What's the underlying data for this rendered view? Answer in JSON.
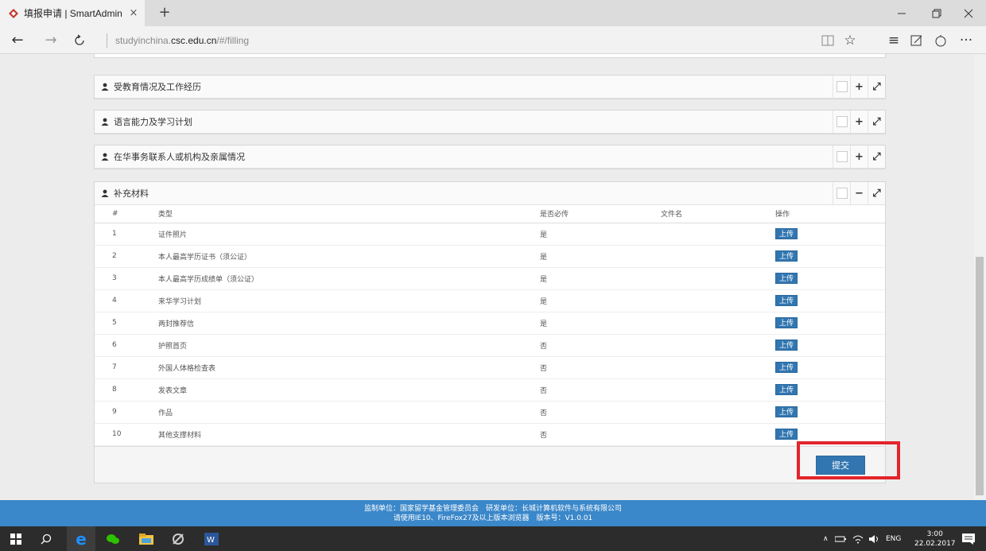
{
  "browser": {
    "tab_title": "填报申请 | SmartAdmin",
    "tab_close": "×",
    "new_tab": "+",
    "url_prefix": "studyinchina.",
    "url_domain": "csc.edu.cn",
    "url_path": "/#/filling"
  },
  "panels": [
    {
      "title": "受教育情况及工作经历",
      "toggle": "+"
    },
    {
      "title": "语言能力及学习计划",
      "toggle": "+"
    },
    {
      "title": "在华事务联系人或机构及亲属情况",
      "toggle": "+"
    }
  ],
  "materials": {
    "title": "补充材料",
    "toggle": "−",
    "columns": [
      "#",
      "类型",
      "是否必传",
      "文件名",
      "操作"
    ],
    "upload_label": "上传",
    "rows": [
      {
        "num": "1",
        "type": "证件照片",
        "required": "是",
        "file": ""
      },
      {
        "num": "2",
        "type": "本人最高学历证书（须公证）",
        "required": "是",
        "file": ""
      },
      {
        "num": "3",
        "type": "本人最高学历成绩单（须公证）",
        "required": "是",
        "file": ""
      },
      {
        "num": "4",
        "type": "来华学习计划",
        "required": "是",
        "file": ""
      },
      {
        "num": "5",
        "type": "两封推荐信",
        "required": "是",
        "file": ""
      },
      {
        "num": "6",
        "type": "护照首页",
        "required": "否",
        "file": ""
      },
      {
        "num": "7",
        "type": "外国人体格检查表",
        "required": "否",
        "file": ""
      },
      {
        "num": "8",
        "type": "发表文章",
        "required": "否",
        "file": ""
      },
      {
        "num": "9",
        "type": "作品",
        "required": "否",
        "file": ""
      },
      {
        "num": "10",
        "type": "其他支撑材料",
        "required": "否",
        "file": ""
      }
    ],
    "submit_label": "提交"
  },
  "footer": {
    "line1": "监制单位：国家留学基金管理委员会　研发单位：长城计算机软件与系统有限公司",
    "line2": "请使用IE10、FireFox27及以上版本浏览器　版本号：V1.0.01"
  },
  "taskbar": {
    "language": "ENG",
    "time": "3:00",
    "date": "22.02.2017"
  },
  "colors": {
    "primary_button": "#3276b1",
    "footer_bg": "#3a87c9",
    "highlight_box": "#e3242b"
  }
}
